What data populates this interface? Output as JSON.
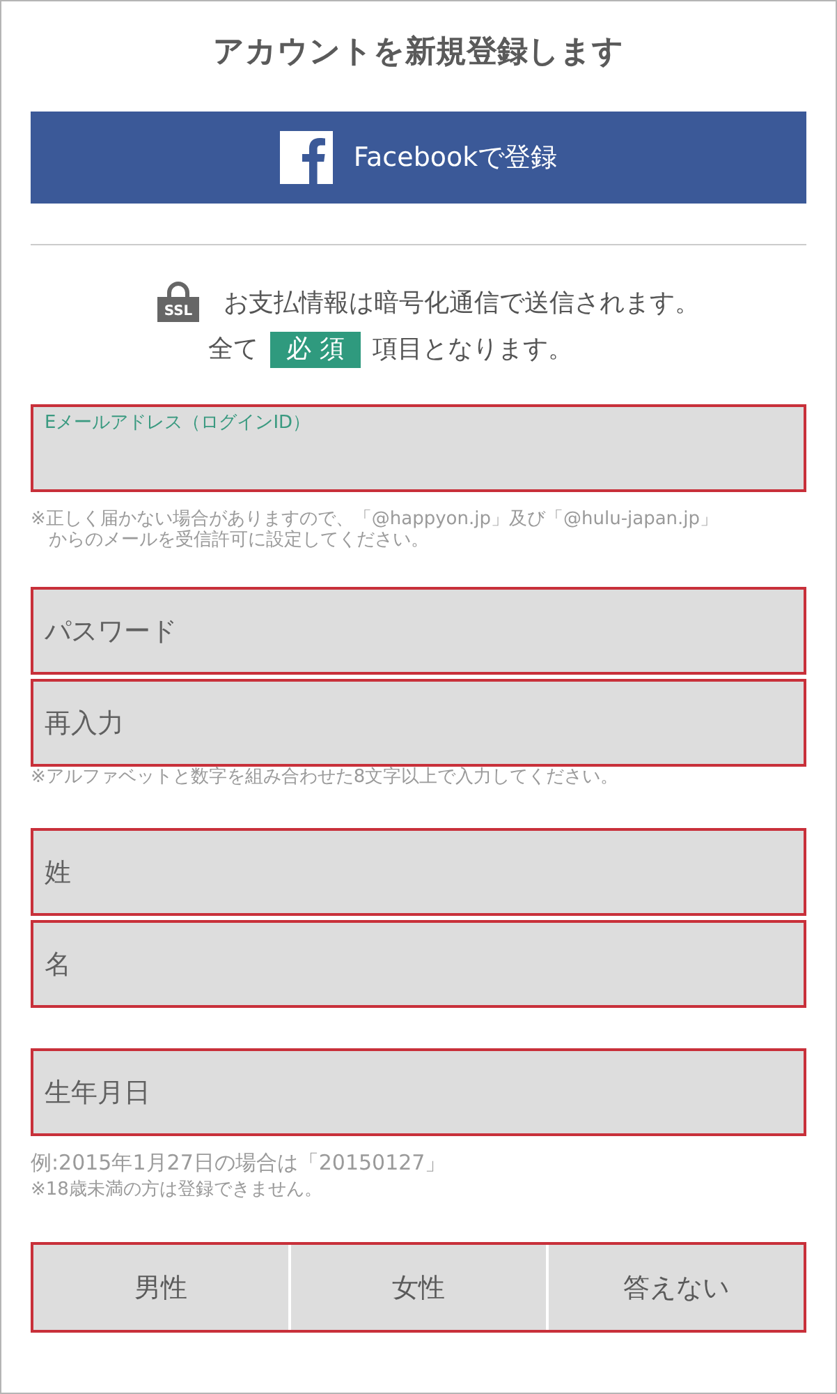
{
  "title": "アカウントを新規登録します",
  "facebook_button": {
    "label": "Facebookで登録"
  },
  "ssl_notice": {
    "icon_text": "SSL",
    "text": "お支払情報は暗号化通信で送信されます。"
  },
  "required_notice": {
    "before": "全て",
    "badge": "必 須",
    "after": "項目となります。"
  },
  "groups": [
    {
      "fields": [
        {
          "kind": "floating",
          "label": "Eメールアドレス（ログインID）"
        }
      ],
      "notes": [
        {
          "kind": "caution",
          "lines": [
            "※正しく届かない場合がありますので、「@happyon.jp」及び「@hulu-japan.jp」",
            "からのメールを受信許可に設定してください。"
          ]
        }
      ]
    },
    {
      "fields": [
        {
          "kind": "placeholder",
          "placeholder": "パスワード"
        },
        {
          "kind": "placeholder",
          "placeholder": "再入力"
        }
      ],
      "notes": [
        {
          "kind": "caution",
          "lines": [
            "※アルファベットと数字を組み合わせた8文字以上で入力してください。"
          ]
        }
      ]
    },
    {
      "fields": [
        {
          "kind": "placeholder",
          "placeholder": "姓"
        },
        {
          "kind": "placeholder",
          "placeholder": "名"
        }
      ]
    },
    {
      "fields": [
        {
          "kind": "placeholder",
          "placeholder": "生年月日"
        }
      ],
      "notes": [
        {
          "kind": "example",
          "lines": [
            "例:2015年1月27日の場合は「20150127」"
          ]
        },
        {
          "kind": "caution",
          "lines": [
            "※18歳未満の方は登録できません。"
          ]
        }
      ]
    }
  ],
  "gender": {
    "options": [
      {
        "label": "男性",
        "selected": false
      },
      {
        "label": "女性",
        "selected": false
      },
      {
        "label": "答えない",
        "selected": false
      }
    ]
  }
}
